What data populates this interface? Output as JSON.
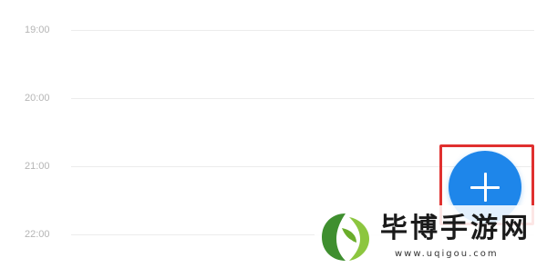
{
  "timeline": {
    "rows": [
      {
        "time": "19:00"
      },
      {
        "time": "20:00"
      },
      {
        "time": "21:00"
      },
      {
        "time": "22:00"
      }
    ]
  },
  "fab": {
    "icon": "plus-icon",
    "color": "#1e86ea"
  },
  "highlight": {
    "color": "#e0302f"
  },
  "watermark": {
    "title": "毕博手游网",
    "url": "www.uqigou.com",
    "logo_colors": [
      "#3f8f2f",
      "#8cc63f"
    ]
  }
}
